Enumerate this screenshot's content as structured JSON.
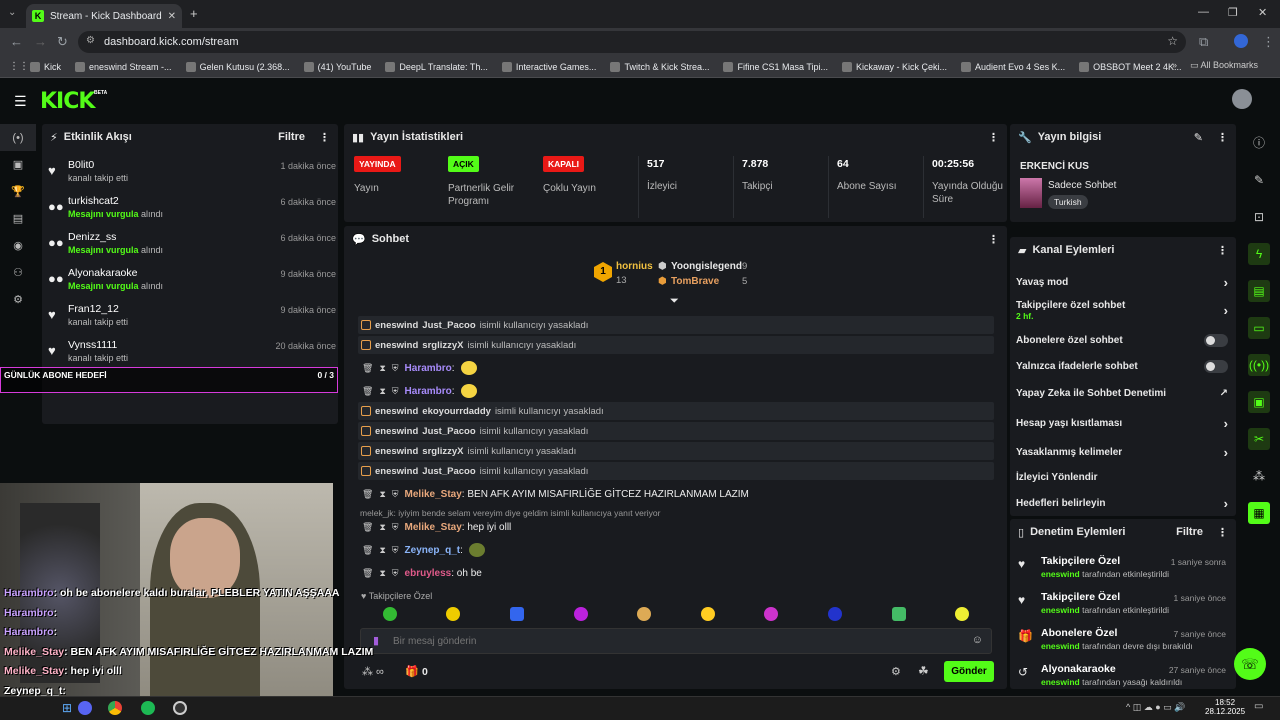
{
  "browser": {
    "tab_title": "Stream - Kick Dashboard",
    "url": "dashboard.kick.com/stream",
    "bookmarks": [
      "Kick",
      "eneswind Stream -...",
      "Gelen Kutusu (2.368...",
      "(41) YouTube",
      "DeepL Translate: Th...",
      "Interactive Games...",
      "Twitch & Kick Strea...",
      "Fifine CS1 Masa Tipi...",
      "Kickaway - Kick Çeki...",
      "Audient Evo 4 Ses K...",
      "OBSBOT Meet 2 4K..."
    ],
    "all_bookmarks": "All Bookmarks"
  },
  "header": {
    "logo": "KICK",
    "beta": "BETA"
  },
  "activity": {
    "title": "Etkinlik Akışı",
    "filter": "Filtre",
    "items": [
      {
        "name": "B0lit0",
        "sub": "kanalı takip etti",
        "time": "1 dakika önce",
        "icon": "heart"
      },
      {
        "name": "turkishcat2",
        "sub_hl": "Mesajını vurgula",
        "sub": " alındı",
        "time": "6 dakika önce",
        "icon": "dots"
      },
      {
        "name": "Denizz_ss",
        "sub_hl": "Mesajını vurgula",
        "sub": " alındı",
        "time": "6 dakika önce",
        "icon": "dots"
      },
      {
        "name": "Alyonakaraoke",
        "sub_hl": "Mesajını vurgula",
        "sub": " alındı",
        "time": "9 dakika önce",
        "icon": "dots"
      },
      {
        "name": "Fran12_12",
        "sub": "kanalı takip etti",
        "time": "9 dakika önce",
        "icon": "heart"
      },
      {
        "name": "Vynss1111",
        "sub": "kanalı takip etti",
        "time": "20 dakika önce",
        "icon": "heart"
      }
    ]
  },
  "stats": {
    "title": "Yayın İstatistikleri",
    "items": [
      {
        "badge": "YAYINDA",
        "badge_color": "#e91916",
        "label": "Yayın"
      },
      {
        "badge": "AÇIK",
        "badge_color": "#53fc18",
        "label": "Partnerlik Gelir Programı"
      },
      {
        "badge": "KAPALI",
        "badge_color": "#e91916",
        "label": "Çoklu Yayın"
      },
      {
        "value": "517",
        "label": "İzleyici"
      },
      {
        "value": "7.878",
        "label": "Takipçi"
      },
      {
        "value": "64",
        "label": "Abone Sayısı"
      },
      {
        "value": "00:25:56",
        "label": "Yayında Olduğu Süre"
      }
    ]
  },
  "stream_info": {
    "title": "Yayın bilgisi",
    "stream_title": "ERKENCİ KUS",
    "category": "Sadece Sohbet",
    "language": "Turkish"
  },
  "chat": {
    "title": "Sohbet",
    "top": [
      {
        "rank": "1",
        "name": "hornius",
        "count": "13"
      },
      {
        "name": "Yoongislegend",
        "count": "9"
      },
      {
        "name": "TomBrave",
        "count": "5"
      }
    ],
    "mod_lines": [
      {
        "mod": "eneswind",
        "user": "Just_Pacoo",
        "text": "isimli kullanıcıyı yasakladı"
      },
      {
        "mod": "eneswind",
        "user": "srglizzyX",
        "text": "isimli kullanıcıyı yasakladı"
      }
    ],
    "msg1": {
      "user": "Harambro",
      "text": ":"
    },
    "msg2": {
      "user": "Harambro",
      "text": ":"
    },
    "mod_lines2": [
      {
        "mod": "eneswind",
        "user": "ekoyourrdaddy",
        "text": "isimli kullanıcıyı yasakladı"
      },
      {
        "mod": "eneswind",
        "user": "Just_Pacoo",
        "text": "isimli kullanıcıyı yasakladı"
      },
      {
        "mod": "eneswind",
        "user": "srglizzyX",
        "text": "isimli kullanıcıyı yasakladı"
      },
      {
        "mod": "eneswind",
        "user": "Just_Pacoo",
        "text": "isimli kullanıcıyı yasakladı"
      }
    ],
    "msg3": {
      "user": "Melike_Stay",
      "text": ": BEN AFK AYIM MISAFIRLİĞE GİTCEZ HAZIRLANMAM LAZIM"
    },
    "reply_hint": "melek_jk: iyiyim bende selam vereyim diye geldim isimli kullanıcıya yanıt veriyor",
    "msg4": {
      "user": "Melike_Stay",
      "text": ": hep iyi olll"
    },
    "msg5": {
      "user": "Zeynep_q_t",
      "text": ":"
    },
    "msg6": {
      "user": "ebruyless",
      "text": ": oh be"
    },
    "follower_only": "Takipçilere Özel",
    "placeholder": "Bir mesaj gönderin",
    "points": "0",
    "send": "Gönder"
  },
  "channel_actions": {
    "title": "Kanal Eylemleri",
    "rows": [
      {
        "label": "Yavaş mod",
        "type": "arrow"
      },
      {
        "label": "Takipçilere özel sohbet",
        "sub": "2 hf.",
        "type": "arrow"
      },
      {
        "label": "Abonelere özel sohbet",
        "type": "toggle"
      },
      {
        "label": "Yalnızca ifadelerle sohbet",
        "type": "toggle"
      },
      {
        "label": "Yapay Zeka ile Sohbet Denetimi",
        "type": "ext"
      },
      {
        "label": "Hesap yaşı kısıtlaması",
        "type": "arrow"
      },
      {
        "label": "Yasaklanmış kelimeler",
        "type": "arrow"
      },
      {
        "label": "İzleyici Yönlendir",
        "type": "none"
      },
      {
        "label": "Hedefleri belirleyin",
        "type": "arrow"
      }
    ]
  },
  "mod_actions": {
    "title": "Denetim Eylemleri",
    "filter": "Filtre",
    "items": [
      {
        "name": "Takipçilere Özel",
        "by": "eneswind",
        "sub": " tarafından etkinleştirildi",
        "time": "1 saniye sonra",
        "icon": "♥"
      },
      {
        "name": "Takipçilere Özel",
        "by": "eneswind",
        "sub": " tarafından etkinleştirildi",
        "time": "1 saniye önce",
        "icon": "♥"
      },
      {
        "name": "Abonelere Özel",
        "by": "eneswind",
        "sub": " tarafından devre dışı bırakıldı",
        "time": "7 saniye önce",
        "icon": "🎁"
      },
      {
        "name": "Alyonakaraoke",
        "by": "eneswind",
        "sub": " tarafından yasağı kaldırıldı",
        "time": "27 saniye önce",
        "icon": "↺"
      }
    ]
  },
  "overlay": {
    "goal_label": "GÜNLÜK ABONE HEDEFİ",
    "goal_value": "0 / 3",
    "lines": [
      {
        "user": "Harambro",
        "text": ": oh be abonelere kaldı buralar, PLEBLER YATIN AŞŞAAA",
        "color": "#c9a2ff"
      },
      {
        "user": "Harambro",
        "text": ":",
        "color": "#c9a2ff"
      },
      {
        "user": "Harambro",
        "text": ":",
        "color": "#c9a2ff"
      },
      {
        "user": "Melike_Stay",
        "text": ": BEN AFK AYIM MISAFIRLİĞE GİTCEZ HAZIRLANMAM LAZIM",
        "color": "#ffb3c8"
      },
      {
        "user": "Melike_Stay",
        "text": ": hep iyi olll",
        "color": "#ffb3c8"
      },
      {
        "user": "Zeynep_q_t",
        "text": ":",
        "color": "#fff"
      }
    ]
  },
  "taskbar": {
    "time": "18:52",
    "date": "28.12.2025"
  }
}
